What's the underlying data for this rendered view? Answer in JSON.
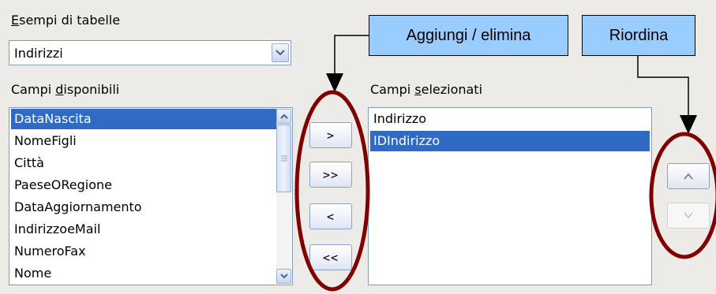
{
  "dialog": {
    "tables_label_prefix": "E",
    "tables_label_rest": "sempi di tabelle",
    "table_combo": {
      "value": "Indirizzi"
    },
    "available_label_prefix": "Campi ",
    "available_label_underline": "d",
    "available_label_rest": "isponibili",
    "selected_label_prefix": "Campi ",
    "selected_label_underline": "s",
    "selected_label_rest": "elezionati",
    "available_fields": [
      {
        "label": "DataNascita",
        "selected": true
      },
      {
        "label": "NomeFigli",
        "selected": false
      },
      {
        "label": "Città",
        "selected": false
      },
      {
        "label": "PaeseORegione",
        "selected": false
      },
      {
        "label": "DataAggiornamento",
        "selected": false
      },
      {
        "label": "IndirizzoeMail",
        "selected": false
      },
      {
        "label": "NumeroFax",
        "selected": false
      },
      {
        "label": "Nome",
        "selected": false
      }
    ],
    "selected_fields": [
      {
        "label": "Indirizzo",
        "selected": false
      },
      {
        "label": "IDIndirizzo",
        "selected": true
      }
    ],
    "move_buttons": {
      "add_one": ">",
      "add_all": ">>",
      "remove_one": "<",
      "remove_all": "<<"
    },
    "order_buttons": {
      "up": "^",
      "down": "v",
      "down_disabled": true
    }
  },
  "annotations": {
    "add_remove_callout": "Aggiungi / elimina",
    "reorder_callout": "Riordina",
    "highlight_color": "#800000",
    "callout_color": "#99ccff"
  },
  "colors": {
    "dialog_background": "#ecebe8",
    "selection": "#316ac5"
  }
}
